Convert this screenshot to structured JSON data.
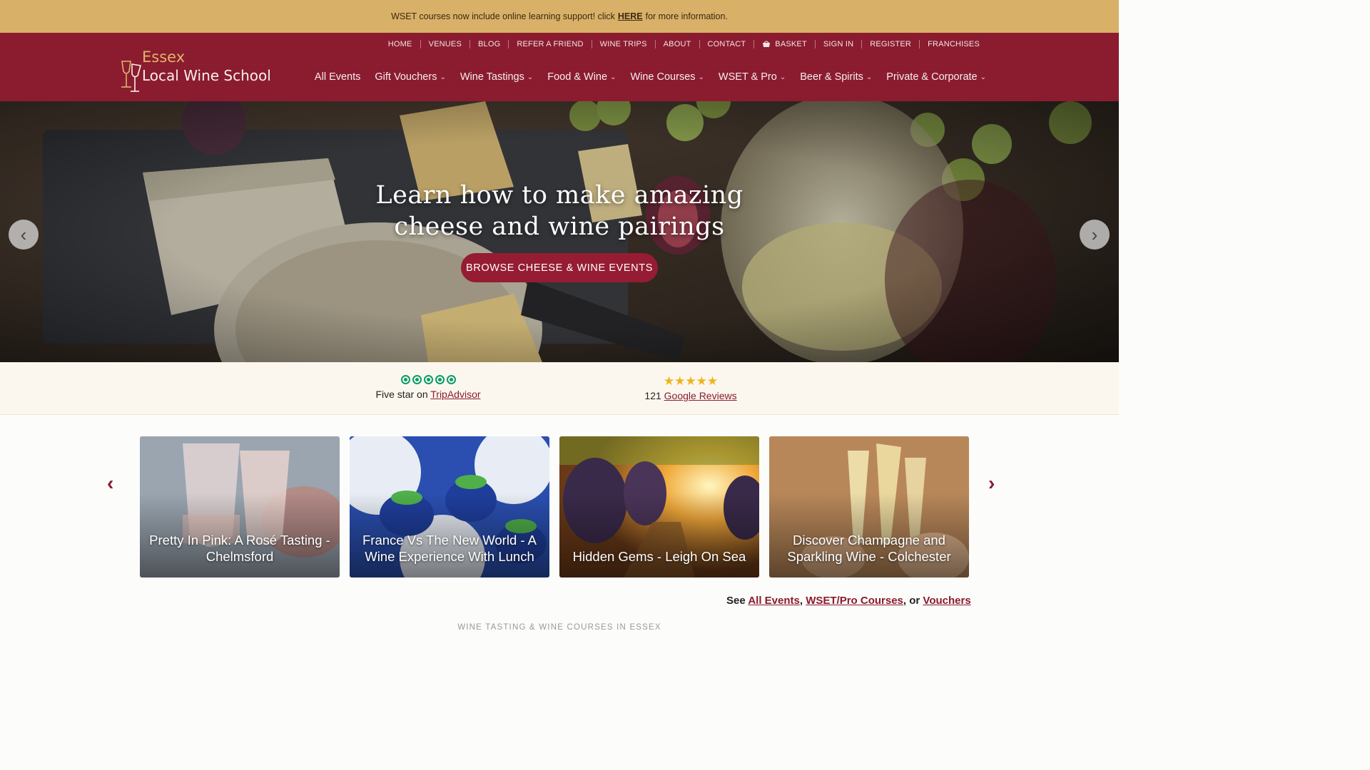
{
  "announcement": {
    "text_before": "WSET courses now include online learning support! click",
    "link": "HERE",
    "text_after": "for more information."
  },
  "logo": {
    "line1": "Essex",
    "line2": "Local Wine School"
  },
  "topnav": [
    "HOME",
    "VENUES",
    "BLOG",
    "REFER A FRIEND",
    "WINE TRIPS",
    "ABOUT",
    "CONTACT",
    "BASKET",
    "SIGN IN",
    "REGISTER",
    "FRANCHISES"
  ],
  "mainnav": [
    "All Events",
    "Gift Vouchers",
    "Wine Tastings",
    "Food & Wine",
    "Wine Courses",
    "WSET & Pro",
    "Beer & Spirits",
    "Private & Corporate"
  ],
  "hero": {
    "title_line1": "Learn how to make amazing",
    "title_line2": "cheese and wine pairings",
    "button": "BROWSE CHEESE & WINE EVENTS"
  },
  "reviews": {
    "tripadvisor_text": "Five star on",
    "tripadvisor_link": "TripAdvisor",
    "google_count": "121",
    "google_link": "Google Reviews"
  },
  "events": [
    {
      "title": "Pretty In Pink: A Rosé Tasting - Chelmsford"
    },
    {
      "title": "France Vs The New World - A Wine Experience With Lunch"
    },
    {
      "title": "Hidden Gems - Leigh On Sea"
    },
    {
      "title": "Discover Champagne and Sparkling Wine - Colchester"
    }
  ],
  "see_line": {
    "prefix": "See",
    "link1": "All Events",
    "link2": "WSET/Pro Courses",
    "mid": ", or",
    "link3": "Vouchers"
  },
  "section_label": "WINE TASTING & WINE COURSES IN ESSEX",
  "colors": {
    "announcement_bg": "#d8b068",
    "header_bg": "#8a1a2e",
    "accent": "#951c32",
    "logo_gold": "#e0b468",
    "tripadvisor_green": "#0a9c6b",
    "star_yellow": "#f0b31c"
  },
  "icons": [
    "basket-icon",
    "chevron-down-icon",
    "chevron-left-icon",
    "chevron-right-icon",
    "tripadvisor-rating-icon",
    "star-icon",
    "wine-glasses-logo-icon"
  ]
}
